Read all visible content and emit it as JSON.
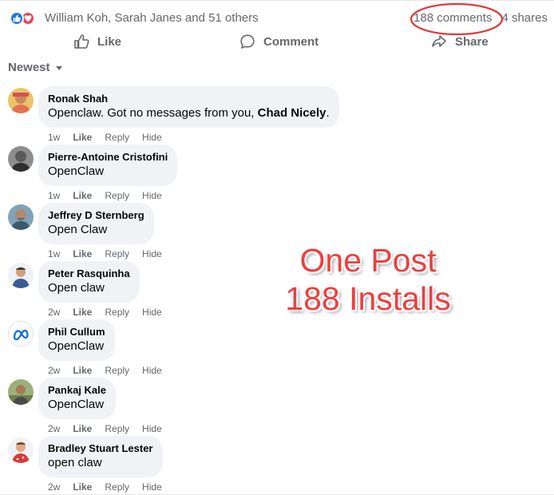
{
  "colors": {
    "accent": "#1877f2",
    "love": "#f33e58",
    "muted": "#65676b",
    "bubble": "#f0f2f5",
    "annotation": "#ef3e3e"
  },
  "summary": {
    "reaction_icons": [
      "like-icon",
      "love-icon"
    ],
    "reactors": "William Koh, Sarah Janes and 51 others",
    "comments_count": "188 comments",
    "shares_count": "4 shares"
  },
  "actions": {
    "like": "Like",
    "comment": "Comment",
    "share": "Share"
  },
  "sort": {
    "label": "Newest"
  },
  "comment_actions": {
    "like": "Like",
    "reply": "Reply",
    "hide": "Hide"
  },
  "comments": [
    {
      "author": "Ronak Shah",
      "text_start": "Openclaw. Got no messages from you, ",
      "mention": "Chad Nicely",
      "text_end": ".",
      "time": "1w"
    },
    {
      "author": "Pierre-Antoine Cristofini",
      "text": "OpenClaw",
      "time": "1w"
    },
    {
      "author": "Jeffrey D Sternberg",
      "text": "Open Claw",
      "time": "1w"
    },
    {
      "author": "Peter Rasquinha",
      "text": "Open claw",
      "time": "2w"
    },
    {
      "author": "Phil Cullum",
      "text": "OpenClaw",
      "time": "2w"
    },
    {
      "author": "Pankaj Kale",
      "text": "OpenClaw",
      "time": "2w"
    },
    {
      "author": "Bradley Stuart Lester",
      "text": "open claw",
      "time": "2w"
    }
  ],
  "annotation": {
    "line1": "One Post",
    "line2": "188 Installs"
  }
}
